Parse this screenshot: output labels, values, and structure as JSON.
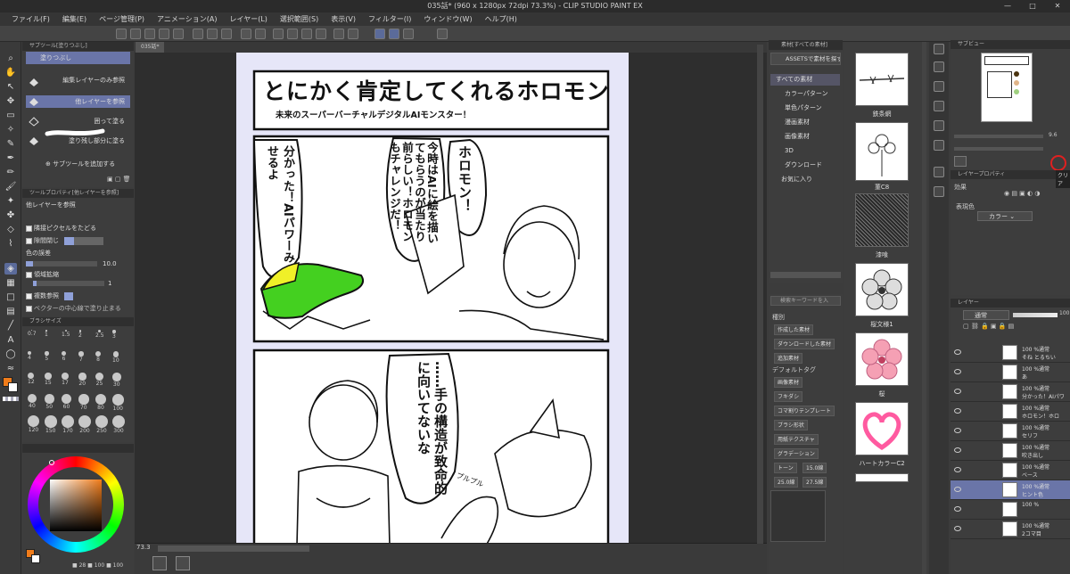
{
  "title_bar": {
    "title": "035話* (960 x 1280px 72dpi 73.3%) - CLIP STUDIO PAINT EX",
    "window_controls": [
      "—",
      "□",
      "✕"
    ]
  },
  "menu": [
    "ファイル(F)",
    "編集(E)",
    "ページ管理(P)",
    "アニメーション(A)",
    "レイヤー(L)",
    "選択範囲(S)",
    "表示(V)",
    "フィルター(I)",
    "ウィンドウ(W)",
    "ヘルプ(H)"
  ],
  "canvas_tab": {
    "label": "035話*"
  },
  "sub_tool": {
    "header": "サブツール[塗りつぶし]",
    "group": "塗りつぶし",
    "items": [
      "編集レイヤーのみ参照",
      "他レイヤーを参照",
      "囲って塗る",
      "塗り残し部分に塗る"
    ],
    "add_label": "サブツールを追加する"
  },
  "tool_property": {
    "header": "ツールプロパティ[他レイヤーを参照]",
    "title": "他レイヤーを参照",
    "rows": [
      {
        "label": "隣接ピクセルをたどる",
        "value": ""
      },
      {
        "label": "隙間閉じ",
        "value": ""
      },
      {
        "label": "色の誤差",
        "value": "10.0"
      },
      {
        "label": "領域拡縮",
        "value": "1"
      },
      {
        "label": "複数参照",
        "value": ""
      },
      {
        "label": "ベクターの中心線で塗り止まる",
        "value": ""
      }
    ]
  },
  "brush_size": {
    "header": "ブラシサイズ",
    "labels": [
      "0.7",
      "1",
      "1.5",
      "2",
      "2.5",
      "3",
      "4",
      "5",
      "6",
      "7",
      "8",
      "10",
      "12",
      "15",
      "17",
      "20",
      "25",
      "30",
      "40",
      "50",
      "60",
      "70",
      "80",
      "100",
      "120",
      "150",
      "170",
      "200",
      "250",
      "300"
    ]
  },
  "color_status": {
    "v1": "28",
    "v2": "100",
    "v3": "100"
  },
  "canvas_status": {
    "zoom": "73.3"
  },
  "comic": {
    "title": "とにかく肯定してくれるホロモン",
    "subtitle": "未来のスーパーバーチャルデジタルAIモンスター！",
    "balloons": [
      "ホロモン！",
      "今時はAIに絵を描いてもらうのが当たり前らしい！ホロモンもチャレンジだ！",
      "分かった！AIパワーみせるよ",
      "……手の構造が致命的に向いてないな"
    ],
    "sfx": "プルプル"
  },
  "material_panel": {
    "header": "素材[すべての素材]",
    "assets_button": "ASSETSで素材を探す",
    "tree": [
      "すべての素材",
      "カラーパターン",
      "単色パターン",
      "漫画素材",
      "画像素材",
      "3D",
      "ダウンロード",
      "お気に入り"
    ],
    "search_placeholder": "検索キーワードを入",
    "tag_header_kind": "種別",
    "kind_tags": [
      "作成した素材",
      "ダウンロードした素材",
      "追加素材"
    ],
    "tag_header_default": "デフォルトタグ",
    "default_tags": [
      "画像素材",
      "フキダシ",
      "コマ割りテンプレート",
      "ブラシ形状",
      "用紙テクスチャ",
      "グラデーション"
    ],
    "tone_row": [
      "トーン",
      "15.0線"
    ],
    "tone_row2": [
      "25.0線",
      "27.5線"
    ],
    "thumbs": [
      "鉄条網",
      "菫C8",
      "漆喰",
      "桜文様1",
      "桜",
      "ハートカラーC2"
    ]
  },
  "navigator": {
    "header": "サブビュー",
    "zoom": "9.6"
  },
  "layer_property": {
    "header": "レイヤープロパティ",
    "effect_label": "効果",
    "expression_label": "表現色",
    "expression_value": "カラー",
    "clear_tooltip": "クリア"
  },
  "layer_panel": {
    "header": "レイヤー",
    "blend_mode": "通常",
    "opacity": "100",
    "layers": [
      {
        "line1": "100 %通常",
        "line2": "そね とるちい"
      },
      {
        "line1": "100 %通常",
        "line2": "あ"
      },
      {
        "line1": "100 %通常",
        "line2": "分かった！AIパワ"
      },
      {
        "line1": "100 %通常",
        "line2": "ホロモン！ホロ"
      },
      {
        "line1": "100 %通常",
        "line2": "セリフ"
      },
      {
        "line1": "100 %通常",
        "line2": "吹き出し"
      },
      {
        "line1": "100 %通常",
        "line2": "ベース"
      },
      {
        "line1": "100 %通常",
        "line2": "ヒント色"
      },
      {
        "line1": "100 %",
        "line2": ""
      },
      {
        "line1": "100 %通常",
        "line2": "2コマ目"
      }
    ]
  },
  "colors": {
    "accent": "#6a75a8",
    "page_bg": "#e6e6f8",
    "main_color": "#f07c1a",
    "highlight_circle": "#e02020",
    "monster_green": "#44d020",
    "monster_yellow": "#f0f028"
  }
}
